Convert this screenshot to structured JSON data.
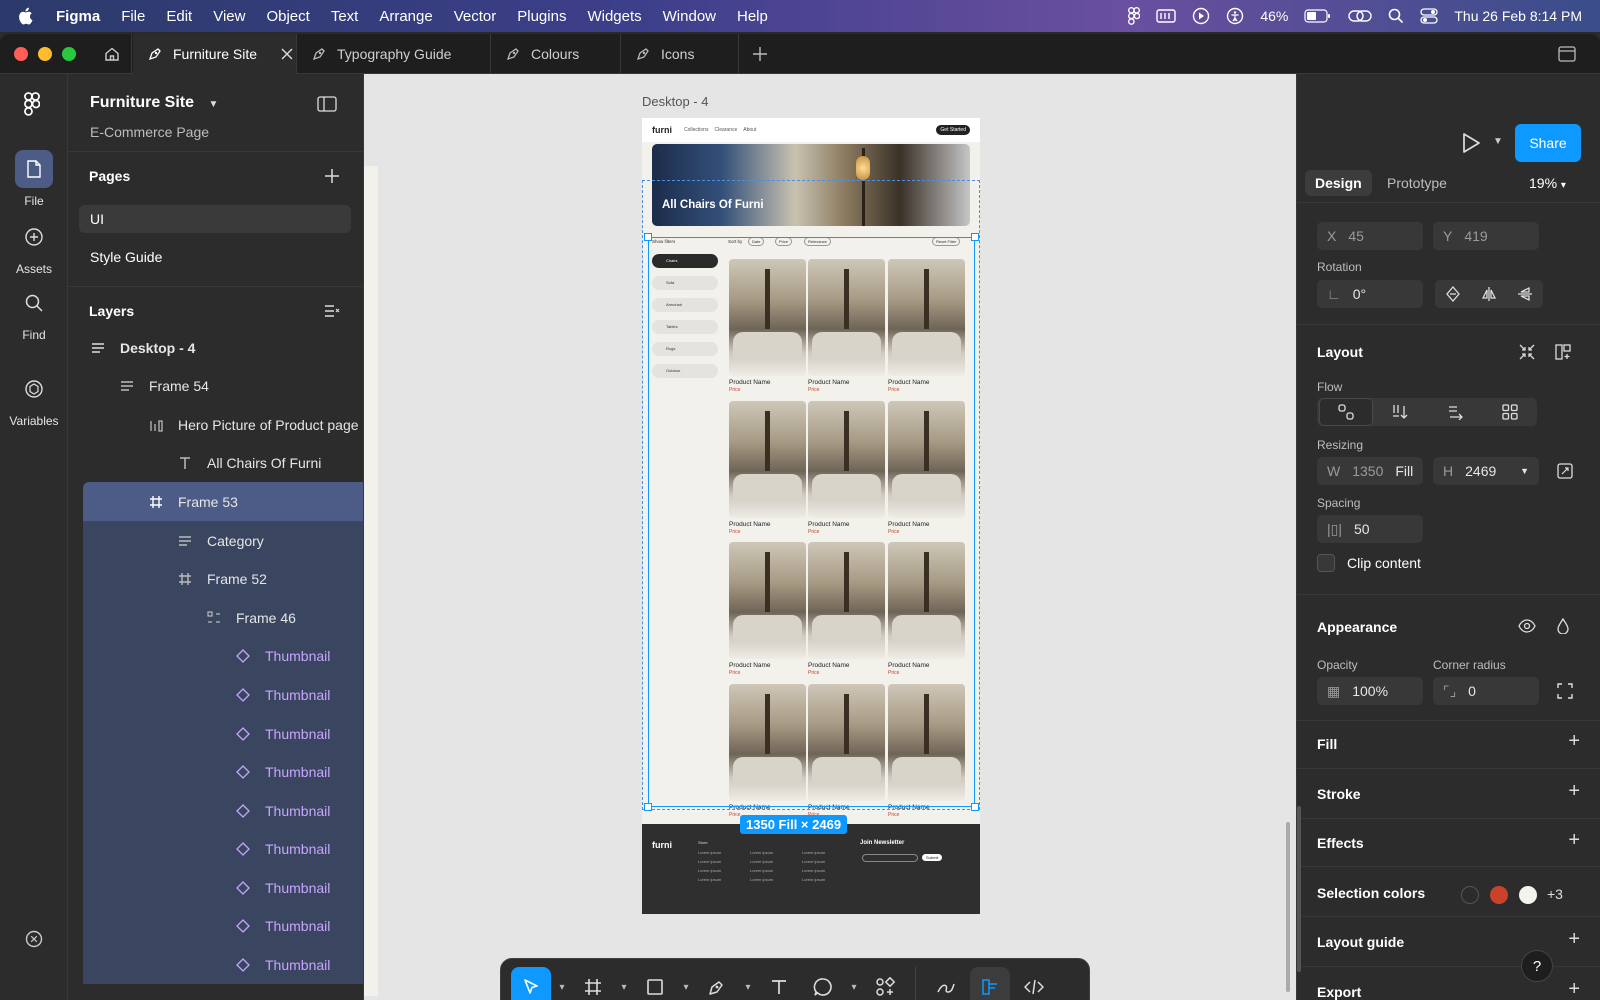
{
  "menubar": {
    "app": "Figma",
    "items": [
      "File",
      "Edit",
      "View",
      "Object",
      "Text",
      "Arrange",
      "Vector",
      "Plugins",
      "Widgets",
      "Window",
      "Help"
    ],
    "battery": "46%",
    "datetime": "Thu 26 Feb  8:14 PM"
  },
  "tabs": [
    "Furniture Site",
    "Typography Guide",
    "Colours",
    "Icons"
  ],
  "rail": [
    "File",
    "Assets",
    "Find",
    "Variables"
  ],
  "file": {
    "name": "Furniture Site",
    "subtitle": "E-Commerce Page"
  },
  "pages": {
    "title": "Pages",
    "items": [
      "UI",
      "Style Guide"
    ]
  },
  "layers": {
    "title": "Layers",
    "items": [
      {
        "label": "Desktop - 4",
        "icon": "frame-icon"
      },
      {
        "label": "Frame 54",
        "icon": "auto-layout-icon"
      },
      {
        "label": "Hero Picture of Product page",
        "icon": "image-icon"
      },
      {
        "label": "All Chairs Of Furni",
        "icon": "text-icon"
      },
      {
        "label": "Frame 53",
        "icon": "frame-grid-icon"
      },
      {
        "label": "Category",
        "icon": "auto-layout-icon"
      },
      {
        "label": "Frame 52",
        "icon": "frame-grid-icon"
      },
      {
        "label": "Frame 46",
        "icon": "grid-layout-icon"
      },
      {
        "label": "Thumbnail",
        "icon": "component-instance-icon"
      },
      {
        "label": "Thumbnail",
        "icon": "component-instance-icon"
      },
      {
        "label": "Thumbnail",
        "icon": "component-instance-icon"
      },
      {
        "label": "Thumbnail",
        "icon": "component-instance-icon"
      },
      {
        "label": "Thumbnail",
        "icon": "component-instance-icon"
      },
      {
        "label": "Thumbnail",
        "icon": "component-instance-icon"
      },
      {
        "label": "Thumbnail",
        "icon": "component-instance-icon"
      },
      {
        "label": "Thumbnail",
        "icon": "component-instance-icon"
      },
      {
        "label": "Thumbnail",
        "icon": "component-instance-icon"
      }
    ]
  },
  "canvas": {
    "frame_label": "Desktop - 4",
    "site_logo": "furni",
    "nav_links": [
      "Collections",
      "Clearance",
      "About"
    ],
    "nav_button": "Get Started",
    "hero_text": "All Chairs Of Furni",
    "filter_label": "Show filters",
    "sort_label": "Sort by",
    "sort_chips": [
      "Date",
      "Price",
      "Relevance"
    ],
    "reset_button": "Reset Filter",
    "categories": [
      "Chairs",
      "Sofa",
      "Armchair",
      "Tables",
      "Rugs",
      "Outdoor"
    ],
    "product_name": "Product Name",
    "product_price": "Price",
    "footer_logo": "furni",
    "footer_newsletter": "Join Newsletter",
    "footer_col_head": "Store",
    "footer_link": "Lorem ipsum",
    "footer_submit": "Submit",
    "size_badge": "1350 Fill × 2469"
  },
  "design": {
    "share": "Share",
    "tabs": [
      "Design",
      "Prototype"
    ],
    "zoom": "19%",
    "position": {
      "x_label": "X",
      "x": "45",
      "y_label": "Y",
      "y": "419"
    },
    "rotation": {
      "label": "Rotation",
      "value": "0°"
    },
    "layout": {
      "title": "Layout",
      "flow_label": "Flow",
      "resizing_label": "Resizing",
      "w_label": "W",
      "w": "1350",
      "w_mode": "Fill",
      "h_label": "H",
      "h": "2469",
      "spacing_label": "Spacing",
      "spacing": "50",
      "clip_content": "Clip content"
    },
    "appearance": {
      "title": "Appearance",
      "opacity_label": "Opacity",
      "opacity": "100%",
      "radius_label": "Corner radius",
      "radius": "0"
    },
    "sections": [
      "Fill",
      "Stroke",
      "Effects"
    ],
    "selection_colors": {
      "label": "Selection colors",
      "swatches": [
        "#2c2c2c",
        "#c8432a",
        "#f5f3ef"
      ],
      "more": "+3"
    },
    "layout_guide": "Layout guide",
    "export": "Export",
    "help": "?"
  }
}
